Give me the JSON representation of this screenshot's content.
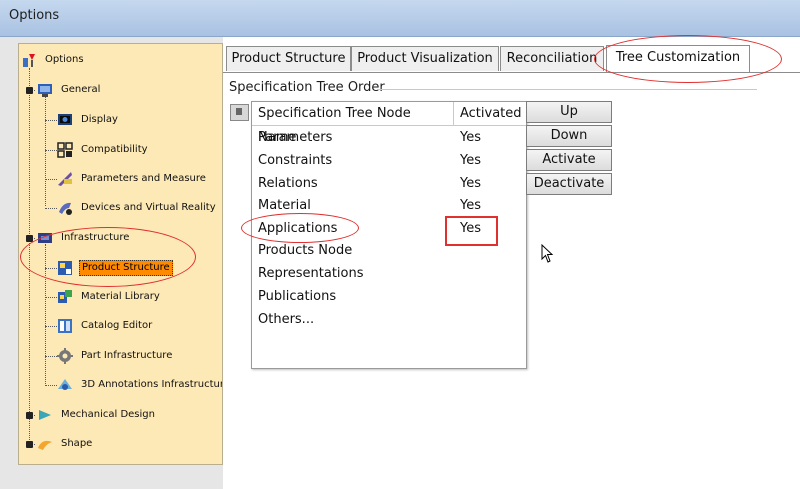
{
  "window": {
    "title": "Options"
  },
  "tree": {
    "root": {
      "label": "Options",
      "icon": "options-icon"
    },
    "nodes": [
      {
        "label": "General",
        "icon": "general-icon"
      },
      {
        "label": "Display",
        "icon": "display-icon"
      },
      {
        "label": "Compatibility",
        "icon": "compatibility-icon"
      },
      {
        "label": "Parameters and Measure",
        "icon": "parameters-icon"
      },
      {
        "label": "Devices and Virtual Reality",
        "icon": "devices-icon"
      },
      {
        "label": "Infrastructure",
        "icon": "infrastructure-icon"
      },
      {
        "label": "Product Structure",
        "icon": "product-structure-icon",
        "selected": true
      },
      {
        "label": "Material Library",
        "icon": "material-library-icon"
      },
      {
        "label": "Catalog Editor",
        "icon": "catalog-editor-icon"
      },
      {
        "label": "Part Infrastructure",
        "icon": "gear-icon"
      },
      {
        "label": "3D Annotations Infrastructure",
        "icon": "annotations-icon"
      },
      {
        "label": "Mechanical Design",
        "icon": "mechanical-design-icon"
      },
      {
        "label": "Shape",
        "icon": "shape-icon"
      }
    ]
  },
  "tabs": [
    {
      "label": "Product Structure"
    },
    {
      "label": "Product Visualization"
    },
    {
      "label": "Reconciliation"
    },
    {
      "label": "Tree Customization",
      "active": true
    }
  ],
  "group": {
    "title": "Specification Tree Order"
  },
  "table": {
    "headers": [
      "Specification Tree Node Name",
      "Activated"
    ],
    "rows": [
      {
        "name": "Parameters",
        "activated": "Yes"
      },
      {
        "name": "Constraints",
        "activated": "Yes"
      },
      {
        "name": "Relations",
        "activated": "Yes"
      },
      {
        "name": "Material",
        "activated": "Yes"
      },
      {
        "name": "Applications",
        "activated": "Yes"
      },
      {
        "name": "Products Node",
        "activated": ""
      },
      {
        "name": "Representations",
        "activated": ""
      },
      {
        "name": "Publications",
        "activated": ""
      },
      {
        "name": "Others...",
        "activated": ""
      }
    ]
  },
  "buttons": {
    "up": "Up",
    "down": "Down",
    "activate": "Activate",
    "deactivate": "Deactivate"
  },
  "colors": {
    "annotation": "#e0302f",
    "selection": "#ff8a00",
    "tree_bg": "#fde9b6"
  }
}
